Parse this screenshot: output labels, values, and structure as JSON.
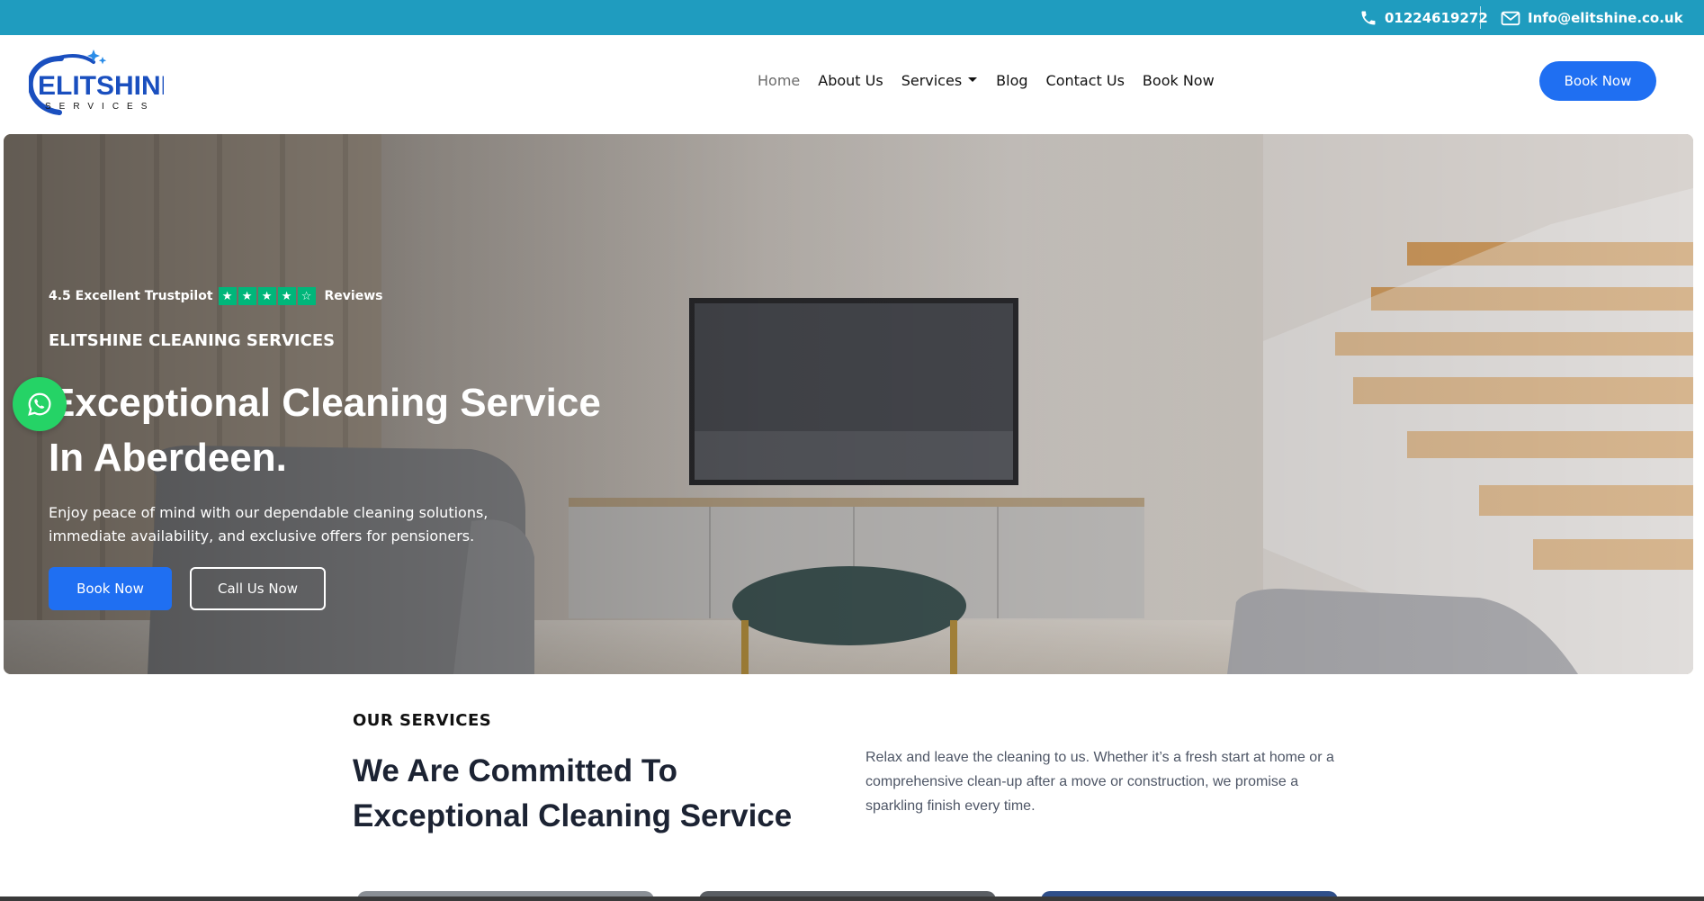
{
  "topbar": {
    "phone": "01224619272",
    "email": "Info@elitshine.co.uk",
    "background": "#1f9cbf"
  },
  "logo": {
    "name": "ELITSHINE",
    "tagline": "SERVICES"
  },
  "nav": {
    "items": [
      {
        "label": "Home",
        "active": true
      },
      {
        "label": "About Us"
      },
      {
        "label": "Services",
        "has_dropdown": true
      },
      {
        "label": "Blog"
      },
      {
        "label": "Contact Us"
      },
      {
        "label": "Book Now"
      }
    ],
    "cta": "Book Now"
  },
  "hero": {
    "rating_prefix": "4.5 Excellent Trustpilot",
    "rating_suffix": "Reviews",
    "rating_value": 4.5,
    "eyebrow": "ELITSHINE CLEANING SERVICES",
    "title_line1": "Exceptional Cleaning Service",
    "title_line2": "In Aberdeen.",
    "desc_line1": "Enjoy peace of mind with our dependable cleaning solutions,",
    "desc_line2": "immediate availability, and exclusive offers for pensioners.",
    "btn_primary": "Book Now",
    "btn_secondary": "Call Us Now"
  },
  "services": {
    "eyebrow": "OUR SERVICES",
    "title_line1": "We Are Committed To",
    "title_line2": "Exceptional Cleaning Service",
    "desc": "Relax and leave the cleaning to us. Whether it’s a fresh start at home or a comprehensive clean-up after a move or construction, we promise a sparkling finish every time."
  },
  "colors": {
    "accent": "#1f6ff2",
    "trustpilot": "#00b67a",
    "whatsapp": "#25d366",
    "heading": "#1c2333"
  }
}
